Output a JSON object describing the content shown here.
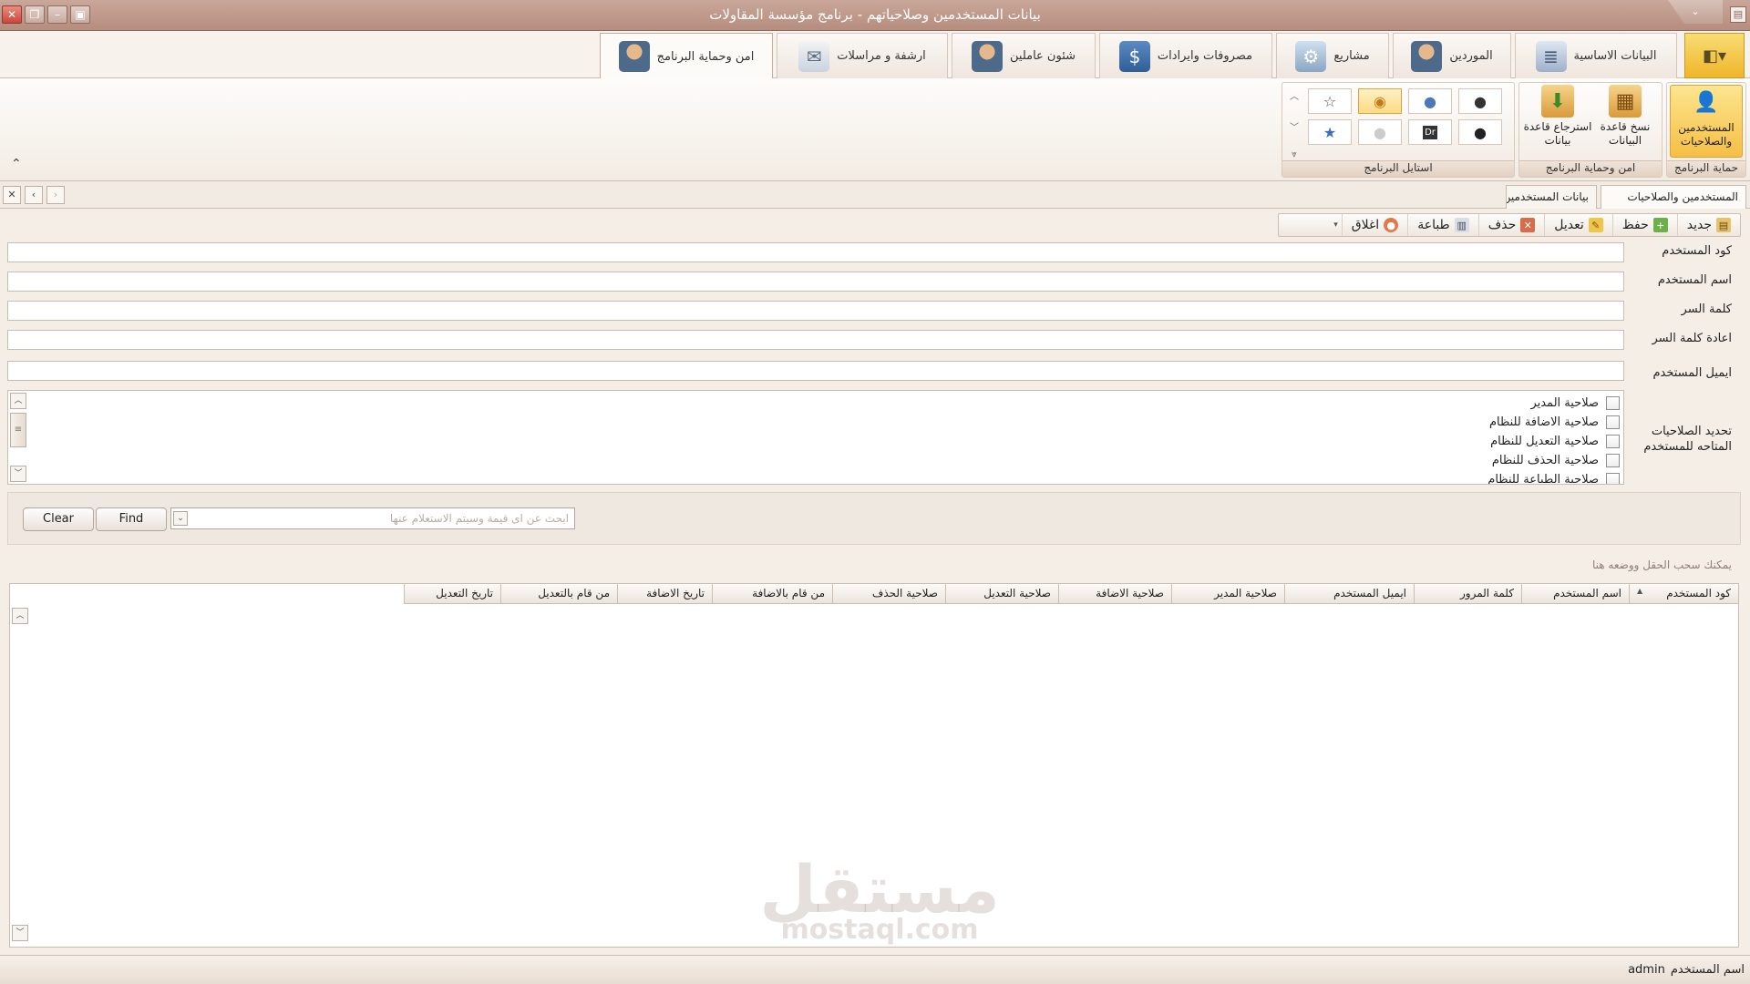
{
  "window": {
    "title": "بيانات المستخدمين وصلاحياتهم - برنامج مؤسسة المقاولات"
  },
  "ribbon_tabs": [
    {
      "label": "البيانات الاساسية",
      "icon": "document-list-icon"
    },
    {
      "label": "الموردين",
      "icon": "supplier-gear-icon"
    },
    {
      "label": "مشاريع",
      "icon": "project-gear-icon"
    },
    {
      "label": "مصروفات وايرادات",
      "icon": "money-tag-icon"
    },
    {
      "label": "شئون عاملين",
      "icon": "worker-icon"
    },
    {
      "label": "ارشفة و مراسلات",
      "icon": "mail-archive-icon"
    },
    {
      "label": "امن وحماية البرنامج",
      "icon": "user-security-icon"
    }
  ],
  "ribbon_groups": {
    "protection": {
      "label": "حماية البرنامج",
      "button": "المستخدمين والصلاحيات"
    },
    "security": {
      "label": "امن وحماية البرنامج",
      "backup": "نسخ قاعدة البيانات",
      "restore": "استرجاع قاعدة بيانات"
    },
    "styles": {
      "label": "استايل البرنامج",
      "swatches": [
        "dark-orb",
        "blue-orb",
        "orange-orb",
        "star-outline",
        "black-orb",
        "dr-tile",
        "white-orb",
        "blue-star"
      ]
    }
  },
  "doc_tabs": [
    {
      "label": "المستخدمين والصلاحيات"
    },
    {
      "label": "بيانات المستخدمين وصلاحياتهم"
    }
  ],
  "toolbar": {
    "new": "جديد",
    "save": "حفظ",
    "edit": "تعديل",
    "delete": "حذف",
    "print": "طباعة",
    "close": "اغلاق"
  },
  "form": {
    "user_code": {
      "label": "كود المستخدم",
      "value": ""
    },
    "user_name": {
      "label": "اسم المستخدم",
      "value": ""
    },
    "password": {
      "label": "كلمة السر",
      "value": ""
    },
    "password_confirm": {
      "label": "اعادة كلمة السر",
      "value": ""
    },
    "email": {
      "label": "ايميل المستخدم",
      "value": ""
    },
    "permissions_label": "تحديد الصلاحيات المتاحه للمستخدم",
    "permissions": [
      {
        "label": "صلاحية المدير",
        "checked": false
      },
      {
        "label": "صلاحية الاضافة للنظام",
        "checked": false
      },
      {
        "label": "صلاحية التعديل للنظام",
        "checked": false
      },
      {
        "label": "صلاحية الحذف للنظام",
        "checked": false
      },
      {
        "label": "صلاحية الطباعة للنظام",
        "checked": false
      }
    ]
  },
  "find_panel": {
    "search_placeholder": "ابحث عن اى قيمة وسيتم الاستعلام عنها",
    "find": "Find",
    "clear": "Clear"
  },
  "group_hint": "يمكنك سحب الحقل ووضعه هنا",
  "grid": {
    "columns": [
      "كود المستخدم",
      "اسم المستخدم",
      "كلمة المرور",
      "ايميل المستخدم",
      "صلاحية المدير",
      "صلاحية الاضافة",
      "صلاحية التعديل",
      "صلاحية الحذف",
      "من قام بالاضافة",
      "تاريخ الاضافة",
      "من قام بالتعديل",
      "تاريخ التعديل"
    ],
    "rows": []
  },
  "watermark": {
    "arabic": "مستقل",
    "latin": "mostaql.com"
  },
  "status": {
    "label": "اسم المستخدم",
    "value": "admin"
  },
  "colors": {
    "titlebar": "#b68d7e",
    "accent": "#f5bf45",
    "background": "#f4eee7"
  }
}
